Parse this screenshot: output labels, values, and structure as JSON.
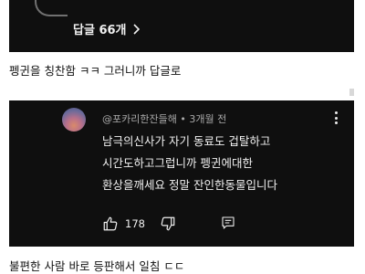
{
  "top_comment": {
    "replies_label": "답글 66개"
  },
  "captions": {
    "first": "펭귄을 칭찬함 ㅋㅋ 그러니까 답글로",
    "second": "불편한 사람 바로 등판해서 일침 ㄷㄷ"
  },
  "comment": {
    "author": "@포카리한잔들해",
    "time": "3개월 전",
    "text_lines": [
      "남극의신사가 자기 동료도 겁탈하고",
      "시간도하고그럽니까 펭귄에대한",
      "환상을깨세요 정말 잔인한동물입니다"
    ],
    "like_count": "178"
  },
  "icons": {
    "chevron": "chevron-right-icon",
    "like": "thumbs-up-icon",
    "dislike": "thumbs-down-icon",
    "reply": "reply-icon",
    "more": "more-vert-icon"
  },
  "colors": {
    "panel_bg": "#0f0f0f",
    "text_light": "#f1f1f1",
    "meta_gray": "#aaaaaa"
  }
}
